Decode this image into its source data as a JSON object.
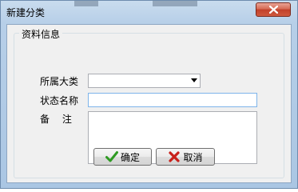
{
  "window": {
    "title": "新建分类"
  },
  "group": {
    "legend": "资料信息"
  },
  "form": {
    "category_label": "所属大类",
    "category_value": "",
    "status_name_label": "状态名称",
    "status_name_value": "",
    "remark_label": "备　 注",
    "remark_value": ""
  },
  "buttons": {
    "ok_label": "确定",
    "ok_icon": "checkmark-icon",
    "cancel_label": "取消",
    "cancel_icon": "x-mark-icon"
  },
  "colors": {
    "titlebar": "#b7cfe8",
    "close_button": "#c2402a",
    "ok_icon_green": "#2e9a22",
    "cancel_icon_red": "#c8201a"
  }
}
